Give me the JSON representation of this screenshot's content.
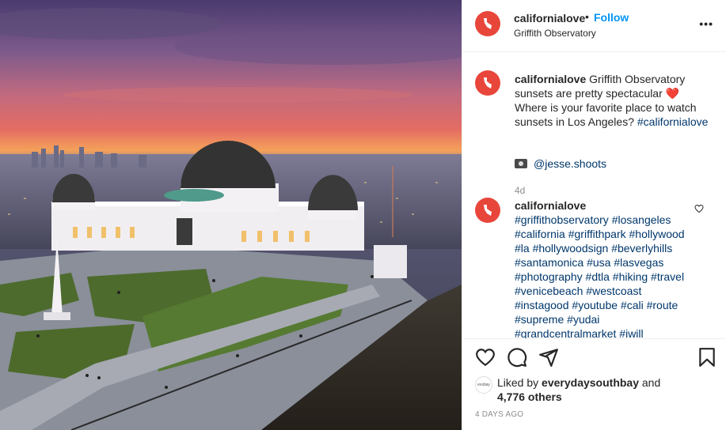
{
  "post": {
    "username": "californialove",
    "separator": "•",
    "follow_label": "Follow",
    "location": "Griffith Observatory",
    "more_label": "•••"
  },
  "caption": {
    "username": "californialove",
    "text_part1": "Griffith Observatory sunsets are pretty spectacular",
    "emoji": "❤️",
    "text_part2": "Where is your favorite place to watch sunsets in Los Angeles?",
    "hashtag": "#californialove",
    "credit": "@jesse.shoots",
    "time": "4d"
  },
  "comment": {
    "username": "californialove",
    "hashtags": [
      "#griffithobservatory",
      "#losangeles",
      "#california",
      "#griffithpark",
      "#hollywood",
      "#la",
      "#hollywoodsign",
      "#beverlyhills",
      "#santamonica",
      "#usa",
      "#lasvegas",
      "#photography",
      "#dtla",
      "#hiking",
      "#travel",
      "#venicebeach",
      "#westcoast",
      "#instagood",
      "#youtube",
      "#cali",
      "#route",
      "#supreme",
      "#yudai",
      "#grandcentralmarket",
      "#iwill"
    ]
  },
  "likes": {
    "prefix": "Liked by",
    "liker": "everydaysouthbay",
    "and": "and",
    "count": "4,776 others",
    "liker_avatar_text": "evsbay"
  },
  "posted_ago": "4 DAYS AGO",
  "icons": {
    "heart": "heart-icon",
    "comment": "comment-icon",
    "share": "share-icon",
    "save": "bookmark-icon",
    "more": "more-options-icon",
    "camera": "camera-icon"
  },
  "colors": {
    "link_blue": "#0095f6",
    "hashtag": "#00376b",
    "avatar_red": "#e8463b",
    "muted": "#8e8e8e"
  }
}
